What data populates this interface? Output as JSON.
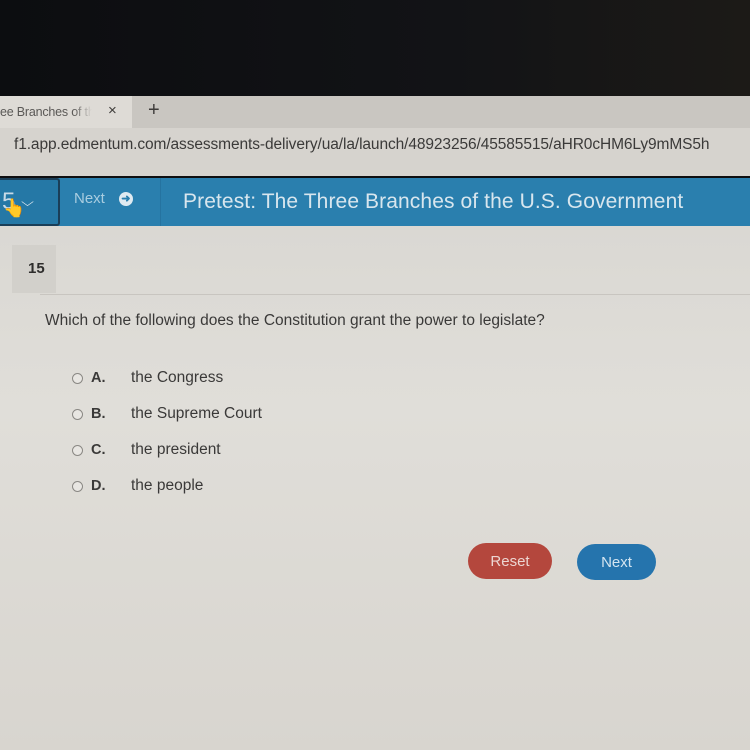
{
  "browser": {
    "tab": {
      "title": "ee Branches of the",
      "close_icon": "×"
    },
    "new_tab_icon": "+",
    "url": "f1.app.edmentum.com/assessments-delivery/ua/la/launch/48923256/45585515/aHR0cHM6Ly9mMS5h"
  },
  "header": {
    "question_selector": "5",
    "chevron_icon": "⌄",
    "next_label": "Next",
    "next_icon": "➔",
    "title": "Pretest: The Three Branches of the U.S. Government",
    "accent_color": "#2a7fae"
  },
  "question": {
    "number": "15",
    "text": "Which of the following does the Constitution grant the power to legislate?",
    "choices": [
      {
        "letter": "A.",
        "text": "the Congress",
        "selected": false
      },
      {
        "letter": "B.",
        "text": "the Supreme Court",
        "selected": false
      },
      {
        "letter": "C.",
        "text": "the president",
        "selected": false
      },
      {
        "letter": "D.",
        "text": "the people",
        "selected": false
      }
    ]
  },
  "actions": {
    "reset_label": "Reset",
    "next_label": "Next",
    "reset_color": "#b4473d",
    "next_color": "#2574ad"
  }
}
